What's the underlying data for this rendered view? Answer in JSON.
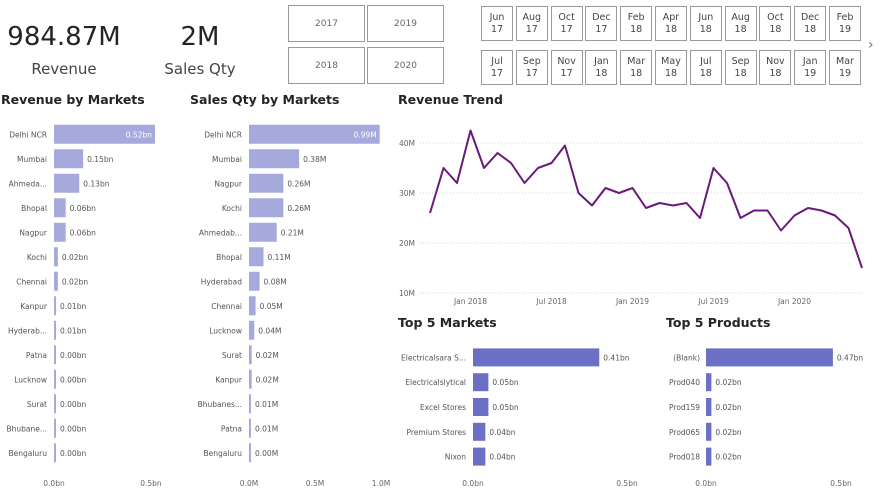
{
  "kpis": {
    "revenue_value": "984.87M",
    "revenue_label": "Revenue",
    "qty_value": "2M",
    "qty_label": "Sales Qty"
  },
  "year_slicer": [
    "2017",
    "2019",
    "2018",
    "2020"
  ],
  "month_slicer": [
    [
      "Jun",
      "17"
    ],
    [
      "Aug",
      "17"
    ],
    [
      "Oct",
      "17"
    ],
    [
      "Dec",
      "17"
    ],
    [
      "Feb",
      "18"
    ],
    [
      "Apr",
      "18"
    ],
    [
      "Jun",
      "18"
    ],
    [
      "Aug",
      "18"
    ],
    [
      "Oct",
      "18"
    ],
    [
      "Dec",
      "18"
    ],
    [
      "Feb",
      "19"
    ],
    [
      "Jul",
      "17"
    ],
    [
      "Sep",
      "17"
    ],
    [
      "Nov",
      "17"
    ],
    [
      "Jan",
      "18"
    ],
    [
      "Mar",
      "18"
    ],
    [
      "May",
      "18"
    ],
    [
      "Jul",
      "18"
    ],
    [
      "Sep",
      "18"
    ],
    [
      "Nov",
      "18"
    ],
    [
      "Jan",
      "19"
    ],
    [
      "Mar",
      "19"
    ]
  ],
  "colors": {
    "bar_light": "#a6a9dc",
    "bar_dark": "#6b70c5",
    "line": "#6a1a7a",
    "grid": "#d9d9d9"
  },
  "chart_data": [
    {
      "type": "bar",
      "orientation": "horizontal",
      "title": "Revenue by Markets",
      "categories": [
        "Delhi NCR",
        "Mumbai",
        "Ahmeda...",
        "Bhopal",
        "Nagpur",
        "Kochi",
        "Chennai",
        "Kanpur",
        "Hyderab...",
        "Patna",
        "Lucknow",
        "Surat",
        "Bhubane...",
        "Bengaluru"
      ],
      "values": [
        0.52,
        0.15,
        0.13,
        0.06,
        0.06,
        0.02,
        0.02,
        0.01,
        0.01,
        0.004,
        0.003,
        0.002,
        0.001,
        0.0005
      ],
      "labels": [
        "0.52bn",
        "0.15bn",
        "0.13bn",
        "0.06bn",
        "0.06bn",
        "0.02bn",
        "0.02bn",
        "0.01bn",
        "0.01bn",
        "0.00bn",
        "0.00bn",
        "0.00bn",
        "0.00bn",
        "0.00bn"
      ],
      "xticks": [
        "0.0bn",
        "0.5bn"
      ],
      "xlim": [
        0,
        0.52
      ]
    },
    {
      "type": "bar",
      "orientation": "horizontal",
      "title": "Sales Qty by Markets",
      "categories": [
        "Delhi NCR",
        "Mumbai",
        "Nagpur",
        "Kochi",
        "Ahmedab...",
        "Bhopal",
        "Hyderabad",
        "Chennai",
        "Lucknow",
        "Surat",
        "Kanpur",
        "Bhubanes...",
        "Patna",
        "Bengaluru"
      ],
      "values": [
        0.99,
        0.38,
        0.26,
        0.26,
        0.21,
        0.11,
        0.08,
        0.05,
        0.04,
        0.02,
        0.02,
        0.01,
        0.01,
        0.004
      ],
      "labels": [
        "0.99M",
        "0.38M",
        "0.26M",
        "0.26M",
        "0.21M",
        "0.11M",
        "0.08M",
        "0.05M",
        "0.04M",
        "0.02M",
        "0.02M",
        "0.01M",
        "0.01M",
        "0.00M"
      ],
      "xticks": [
        "0.0M",
        "0.5M",
        "1.0M"
      ],
      "xlim": [
        0,
        1.0
      ]
    },
    {
      "type": "line",
      "title": "Revenue Trend",
      "x": [
        "2017-10",
        "2017-11",
        "2017-12",
        "2018-01",
        "2018-02",
        "2018-03",
        "2018-04",
        "2018-05",
        "2018-06",
        "2018-07",
        "2018-08",
        "2018-09",
        "2018-10",
        "2018-11",
        "2018-12",
        "2019-01",
        "2019-02",
        "2019-03",
        "2019-04",
        "2019-05",
        "2019-06",
        "2019-07",
        "2019-08",
        "2019-09",
        "2019-10",
        "2019-11",
        "2019-12",
        "2020-01",
        "2020-02",
        "2020-03",
        "2020-04",
        "2020-05",
        "2020-06"
      ],
      "y": [
        26,
        35,
        32,
        42.5,
        35,
        38,
        36,
        32,
        35,
        36,
        39.5,
        30,
        27.5,
        31,
        30,
        31,
        27,
        28,
        27.5,
        28,
        25,
        35,
        32,
        25,
        26.5,
        26.5,
        22.5,
        25.5,
        27,
        26.5,
        25.5,
        23,
        15
      ],
      "ylim": [
        10,
        45
      ],
      "yticks": [
        [
          "10M",
          10
        ],
        [
          "20M",
          20
        ],
        [
          "30M",
          30
        ],
        [
          "40M",
          40
        ]
      ],
      "xticks": [
        [
          "Jan 2018",
          "2018-01"
        ],
        [
          "Jul 2018",
          "2018-07"
        ],
        [
          "Jan 2019",
          "2019-01"
        ],
        [
          "Jul 2019",
          "2019-07"
        ],
        [
          "Jan 2020",
          "2020-01"
        ]
      ]
    },
    {
      "type": "bar",
      "orientation": "horizontal",
      "title": "Top 5 Markets",
      "categories": [
        "Electricalsara S...",
        "Electricalslytical",
        "Excel Stores",
        "Premium Stores",
        "Nixon"
      ],
      "values": [
        0.41,
        0.05,
        0.05,
        0.04,
        0.04
      ],
      "labels": [
        "0.41bn",
        "0.05bn",
        "0.05bn",
        "0.04bn",
        "0.04bn"
      ],
      "xticks": [
        "0.0bn",
        "0.5bn"
      ],
      "xlim": [
        0,
        0.5
      ]
    },
    {
      "type": "bar",
      "orientation": "horizontal",
      "title": "Top 5 Products",
      "categories": [
        "(Blank)",
        "Prod040",
        "Prod159",
        "Prod065",
        "Prod018"
      ],
      "values": [
        0.47,
        0.02,
        0.02,
        0.02,
        0.02
      ],
      "labels": [
        "0.47bn",
        "0.02bn",
        "0.02bn",
        "0.02bn",
        "0.02bn"
      ],
      "xticks": [
        "0.0bn",
        "0.5bn"
      ],
      "xlim": [
        0,
        0.5
      ]
    }
  ]
}
